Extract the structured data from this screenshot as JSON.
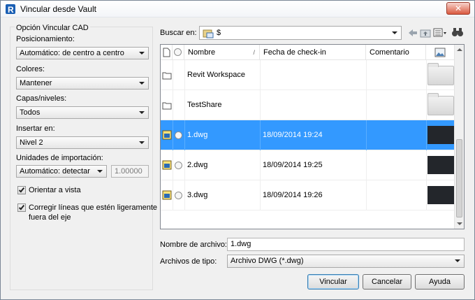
{
  "window": {
    "title": "Vincular desde Vault",
    "close_symbol": "✕"
  },
  "options": {
    "group_title": "Opción Vincular CAD",
    "positioning": {
      "label": "Posicionamiento:",
      "value": "Automático: de centro a centro"
    },
    "colors": {
      "label": "Colores:",
      "value": "Mantener"
    },
    "layers": {
      "label": "Capas/niveles:",
      "value": "Todos"
    },
    "insert": {
      "label": "Insertar en:",
      "value": "Nivel 2"
    },
    "units": {
      "label": "Unidades de importación:",
      "value": "Automático: detectar",
      "factor": "1.00000"
    },
    "orient": {
      "label": "Orientar a vista",
      "checked": true
    },
    "correct": {
      "label_line1": "Corregir líneas que estén ligeramente",
      "label_line2": "fuera del eje",
      "checked": true
    }
  },
  "lookin": {
    "label": "Buscar en:",
    "value": "$"
  },
  "list": {
    "columns": {
      "name": "Nombre",
      "checkin": "Fecha de check-in",
      "comment": "Comentario"
    },
    "rows": [
      {
        "name": "Revit Workspace",
        "date": "",
        "comment": "",
        "type": "folder"
      },
      {
        "name": "TestShare",
        "date": "",
        "comment": "",
        "type": "folder"
      },
      {
        "name": "1.dwg",
        "date": "18/09/2014 19:24",
        "comment": "",
        "type": "dwg",
        "selected": true
      },
      {
        "name": "2.dwg",
        "date": "18/09/2014 19:25",
        "comment": "",
        "type": "dwg"
      },
      {
        "name": "3.dwg",
        "date": "18/09/2014 19:26",
        "comment": "",
        "type": "dwg"
      }
    ]
  },
  "filename": {
    "label": "Nombre de archivo:",
    "value": "1.dwg"
  },
  "filetype": {
    "label": "Archivos de tipo:",
    "value": "Archivo DWG (*.dwg)"
  },
  "buttons": {
    "link": "Vincular",
    "cancel": "Cancelar",
    "help": "Ayuda"
  }
}
